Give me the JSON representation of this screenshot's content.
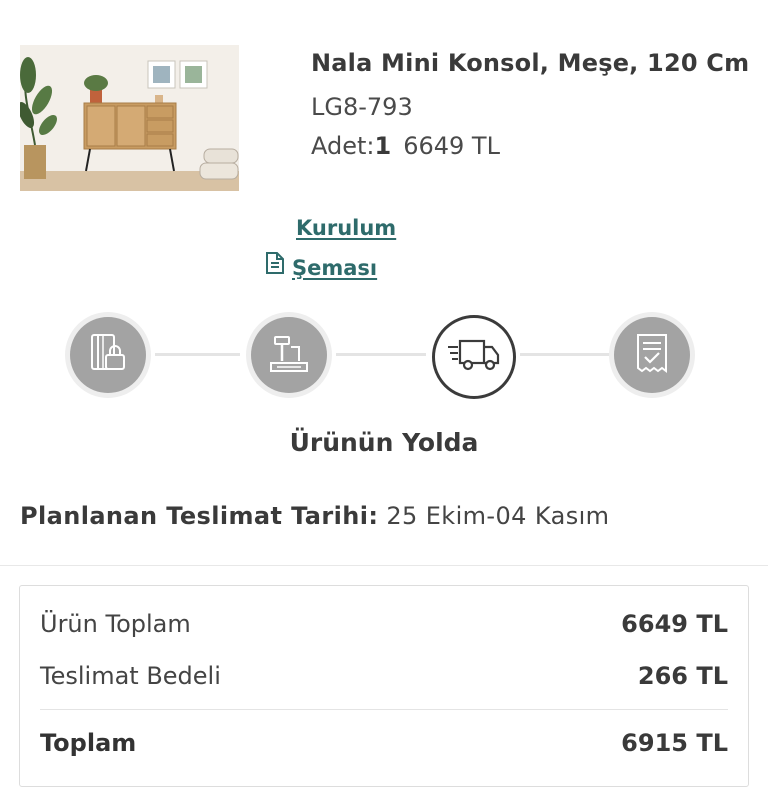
{
  "product": {
    "title": "Nala Mini Konsol, Meşe, 120 Cm",
    "sku": "LG8-793",
    "qty_label": "Adet:",
    "qty_value": "1",
    "price": "6649 TL"
  },
  "install_link": {
    "line1": "Kurulum",
    "line2": "Şeması",
    "icon": "document-icon"
  },
  "steps": [
    {
      "icon": "card-lock-icon",
      "active": false
    },
    {
      "icon": "hammer-tools-icon",
      "active": false
    },
    {
      "icon": "delivery-truck-icon",
      "active": true
    },
    {
      "icon": "receipt-check-icon",
      "active": false
    }
  ],
  "status": "Ürünün Yolda",
  "delivery": {
    "label": "Planlanan Teslimat Tarihi:",
    "value": "25 Ekim-04 Kasım"
  },
  "summary": {
    "subtotal_label": "Ürün Toplam",
    "subtotal_value": "6649 TL",
    "shipping_label": "Teslimat Bedeli",
    "shipping_value": "266 TL",
    "total_label": "Toplam",
    "total_value": "6915 TL"
  },
  "colors": {
    "link": "#2e6b6b",
    "step_inactive": "#a3a3a3",
    "step_active_border": "#3b3b3b"
  }
}
